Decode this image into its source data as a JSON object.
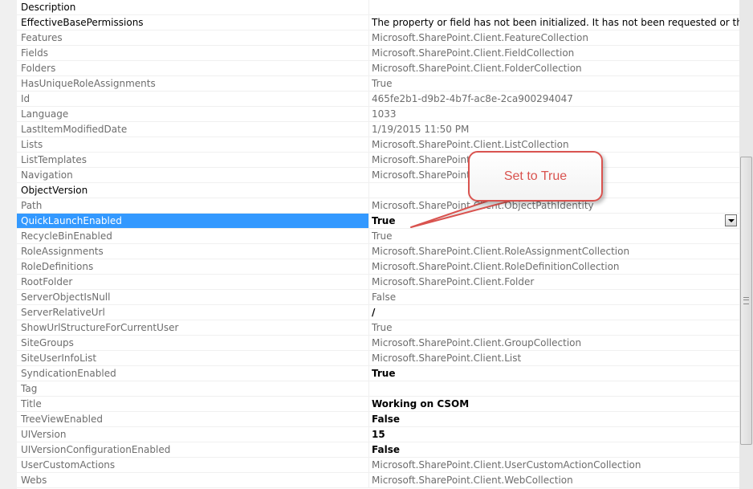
{
  "properties": [
    {
      "name": "Description",
      "value": "",
      "style": "bold"
    },
    {
      "name": "EffectiveBasePermissions",
      "value": "The property or field has not been initialized. It has not been requested or the request h",
      "style": "bold"
    },
    {
      "name": "Features",
      "value": "Microsoft.SharePoint.Client.FeatureCollection",
      "style": ""
    },
    {
      "name": "Fields",
      "value": "Microsoft.SharePoint.Client.FieldCollection",
      "style": ""
    },
    {
      "name": "Folders",
      "value": "Microsoft.SharePoint.Client.FolderCollection",
      "style": ""
    },
    {
      "name": "HasUniqueRoleAssignments",
      "value": "True",
      "style": ""
    },
    {
      "name": "Id",
      "value": "465fe2b1-d9b2-4b7f-ac8e-2ca900294047",
      "style": ""
    },
    {
      "name": "Language",
      "value": "1033",
      "style": ""
    },
    {
      "name": "LastItemModifiedDate",
      "value": "1/19/2015 11:50 PM",
      "style": ""
    },
    {
      "name": "Lists",
      "value": "Microsoft.SharePoint.Client.ListCollection",
      "style": ""
    },
    {
      "name": "ListTemplates",
      "value": "Microsoft.SharePoint.C",
      "style": ""
    },
    {
      "name": "Navigation",
      "value": "Microsoft.SharePoint.C",
      "style": ""
    },
    {
      "name": "ObjectVersion",
      "value": "",
      "style": "bold"
    },
    {
      "name": "Path",
      "value": "Microsoft.SharePoint.Client.ObjectPathIdentity",
      "style": ""
    },
    {
      "name": "QuickLaunchEnabled",
      "value": "True",
      "style": "selected"
    },
    {
      "name": "RecycleBinEnabled",
      "value": "True",
      "style": ""
    },
    {
      "name": "RoleAssignments",
      "value": "Microsoft.SharePoint.Client.RoleAssignmentCollection",
      "style": ""
    },
    {
      "name": "RoleDefinitions",
      "value": "Microsoft.SharePoint.Client.RoleDefinitionCollection",
      "style": ""
    },
    {
      "name": "RootFolder",
      "value": "Microsoft.SharePoint.Client.Folder",
      "style": ""
    },
    {
      "name": "ServerObjectIsNull",
      "value": "False",
      "style": ""
    },
    {
      "name": "ServerRelativeUrl",
      "value": "/",
      "style": "strong"
    },
    {
      "name": "ShowUrlStructureForCurrentUser",
      "value": "True",
      "style": ""
    },
    {
      "name": "SiteGroups",
      "value": "Microsoft.SharePoint.Client.GroupCollection",
      "style": ""
    },
    {
      "name": "SiteUserInfoList",
      "value": "Microsoft.SharePoint.Client.List",
      "style": ""
    },
    {
      "name": "SyndicationEnabled",
      "value": "True",
      "style": "strong"
    },
    {
      "name": "Tag",
      "value": "",
      "style": ""
    },
    {
      "name": "Title",
      "value": "Working on CSOM",
      "style": "strong"
    },
    {
      "name": "TreeViewEnabled",
      "value": "False",
      "style": "strong"
    },
    {
      "name": "UIVersion",
      "value": "15",
      "style": "strong"
    },
    {
      "name": "UIVersionConfigurationEnabled",
      "value": "False",
      "style": "strong"
    },
    {
      "name": "UserCustomActions",
      "value": "Microsoft.SharePoint.Client.UserCustomActionCollection",
      "style": ""
    },
    {
      "name": "Webs",
      "value": "Microsoft.SharePoint.Client.WebCollection",
      "style": ""
    }
  ],
  "callout": {
    "text": "Set to True"
  },
  "colors": {
    "selection": "#3399ff",
    "callout_border": "#d9534f",
    "dim_text": "#6d6d6d"
  }
}
